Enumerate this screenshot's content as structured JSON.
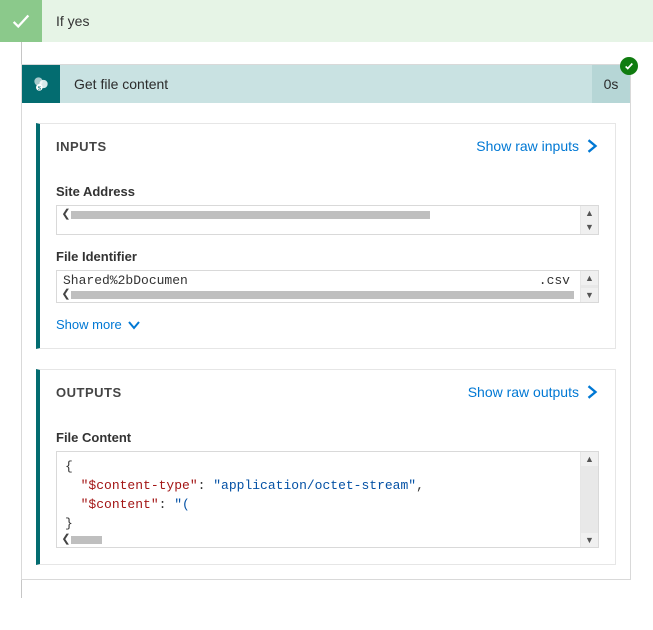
{
  "condition": {
    "label": "If yes"
  },
  "action": {
    "title": "Get file content",
    "duration": "0s"
  },
  "inputs": {
    "title": "INPUTS",
    "show_raw": "Show raw inputs",
    "site_address_label": "Site Address",
    "site_address_value": "",
    "file_identifier_label": "File Identifier",
    "file_identifier_prefix": "Shared%2bDocumen",
    "file_identifier_suffix": ".csv",
    "show_more": "Show more"
  },
  "outputs": {
    "title": "OUTPUTS",
    "show_raw": "Show raw outputs",
    "file_content_label": "File Content",
    "json": {
      "open": "{",
      "key1": "\"$content-type\"",
      "val1": "\"application/octet-stream\"",
      "comma": ",",
      "key2": "\"$content\"",
      "val2": "\"(",
      "close": "}"
    }
  }
}
